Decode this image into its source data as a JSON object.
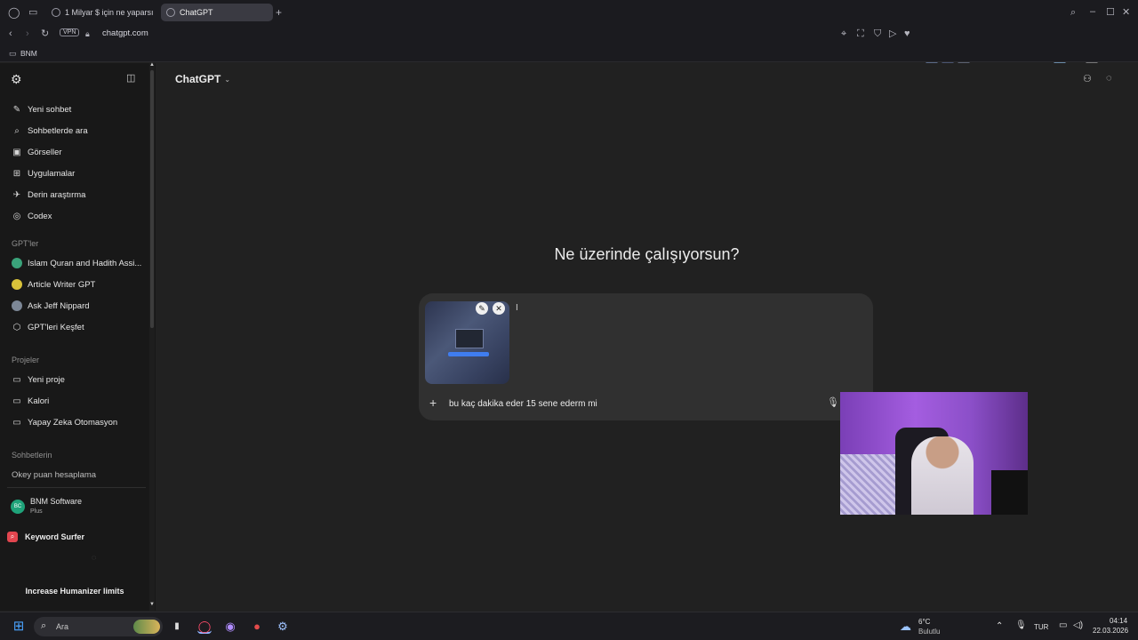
{
  "browser": {
    "tabs": [
      {
        "label": "1 Milyar $ için ne yaparsın"
      },
      {
        "label": "ChatGPT"
      }
    ],
    "new_tab": "+",
    "vpn": "VPN",
    "url": "chatgpt.com",
    "bookmark": "BNM"
  },
  "sidebar": {
    "items": [
      {
        "label": "Yeni sohbet",
        "icon": "✎"
      },
      {
        "label": "Sohbetlerde ara",
        "icon": "⌕"
      },
      {
        "label": "Görseller",
        "icon": "▣"
      },
      {
        "label": "Uygulamalar",
        "icon": "⊞"
      },
      {
        "label": "Derin araştırma",
        "icon": "✈"
      },
      {
        "label": "Codex",
        "icon": "◎"
      }
    ],
    "gpts_heading": "GPT'ler",
    "gpts": [
      {
        "label": "Islam Quran and Hadith Assi...",
        "color": "#3aa37a"
      },
      {
        "label": "Article Writer GPT",
        "color": "#d8c23a"
      },
      {
        "label": "Ask Jeff Nippard",
        "color": "#7c8796"
      },
      {
        "label": "GPT'leri Keşfet",
        "color": "#2b2b2b"
      }
    ],
    "projects_heading": "Projeler",
    "projects": [
      {
        "label": "Yeni proje"
      },
      {
        "label": "Kalori"
      },
      {
        "label": "Yapay Zeka Otomasyon"
      }
    ],
    "chats_heading": "Sohbetlerin",
    "chats": [
      {
        "label": "Okey puan hesaplama"
      }
    ],
    "user": {
      "initials": "BC",
      "name": "BNM Software",
      "plan": "Plus"
    },
    "keyword_surfer": "Keyword Surfer",
    "humanizer": "Increase Humanizer limits"
  },
  "main": {
    "title": "ChatGPT",
    "heading": "Ne üzerinde çalışıyorsun?",
    "input_value": "bu kaç dakika eder 15 sene ederm mi"
  },
  "taskbar": {
    "search_placeholder": "Ara",
    "weather_temp": "6°C",
    "weather_desc": "Bulutlu",
    "lang": "TUR",
    "time": "04:14",
    "date": "22.03.2026"
  },
  "colors": {
    "background": "#212121",
    "sidebar": "#181818",
    "composer": "#303030",
    "user_avatar": "#1fa37a"
  }
}
